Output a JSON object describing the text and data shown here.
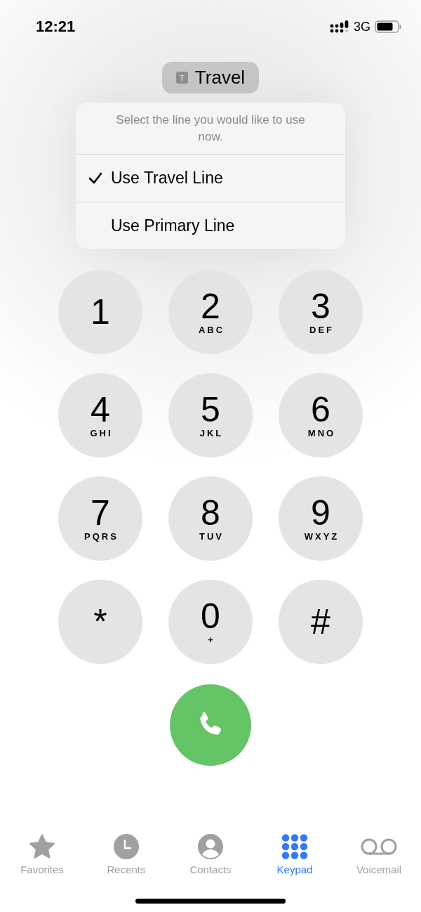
{
  "status_bar": {
    "time": "12:21",
    "network": "3G"
  },
  "line_selector": {
    "badge": "T",
    "label": "Travel"
  },
  "line_menu": {
    "message": "Select the line you would like to use now.",
    "items": [
      {
        "label": "Use Travel Line",
        "selected": true
      },
      {
        "label": "Use Primary Line",
        "selected": false
      }
    ]
  },
  "keypad": [
    {
      "digit": "1"
    },
    {
      "digit": "2",
      "letters": "ABC"
    },
    {
      "digit": "3",
      "letters": "DEF"
    },
    {
      "digit": "4",
      "letters": "GHI"
    },
    {
      "digit": "5",
      "letters": "JKL"
    },
    {
      "digit": "6",
      "letters": "MNO"
    },
    {
      "digit": "7",
      "letters": "PQRS"
    },
    {
      "digit": "8",
      "letters": "TUV"
    },
    {
      "digit": "9",
      "letters": "WXYZ"
    },
    {
      "digit": "*"
    },
    {
      "digit": "0",
      "letters": "+"
    },
    {
      "digit": "#"
    }
  ],
  "tabs": [
    {
      "label": "Favorites",
      "kind": "star",
      "selected": false
    },
    {
      "label": "Recents",
      "kind": "clock",
      "selected": false
    },
    {
      "label": "Contacts",
      "kind": "person",
      "selected": false
    },
    {
      "label": "Keypad",
      "kind": "keypad",
      "selected": true
    },
    {
      "label": "Voicemail",
      "kind": "voicemail",
      "selected": false
    }
  ]
}
